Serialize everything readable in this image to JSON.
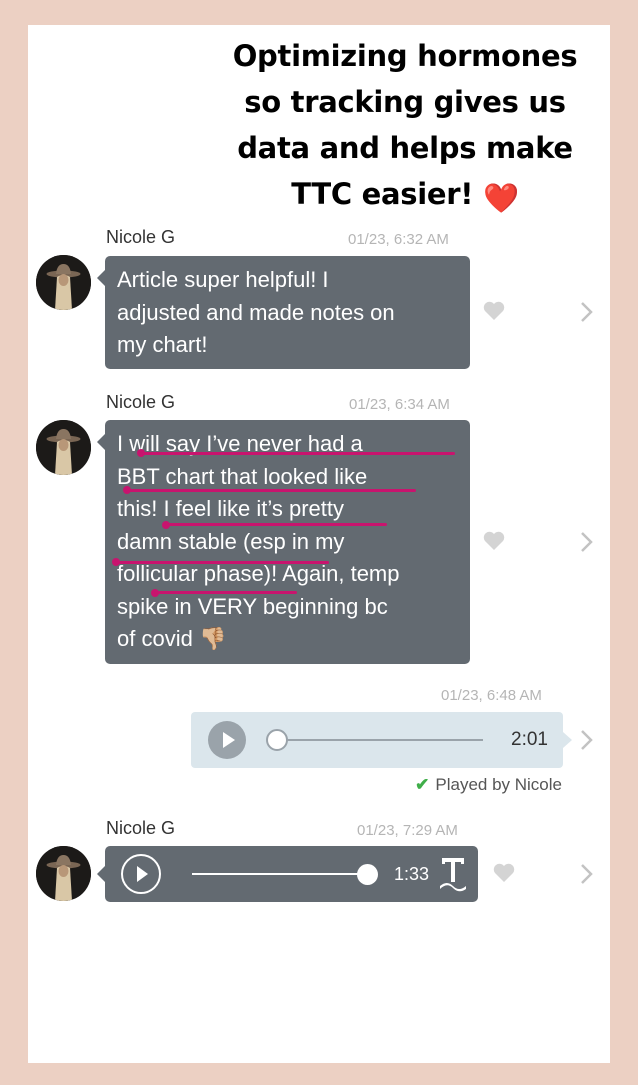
{
  "headline": {
    "line1": "Optimizing hormones",
    "line2": "so tracking gives us",
    "line3": "data and helps make",
    "line4": "TTC easier!",
    "emoji": "❤️"
  },
  "messages": [
    {
      "sender": "Nicole G",
      "time": "01/23, 6:32 AM",
      "lines": [
        "Article super helpful! I",
        "adjusted and made notes on",
        "my chart!"
      ]
    },
    {
      "sender": "Nicole G",
      "time": "01/23, 6:34 AM",
      "lines": [
        "I will say I’ve never had a",
        "BBT chart that looked like",
        "this! I feel like it’s pretty",
        "damn stable (esp in my",
        "follicular phase)! Again, temp",
        "spike in VERY beginning bc",
        "of covid"
      ],
      "emoji": "👎🏼"
    }
  ],
  "outgoing_voice": {
    "time": "01/23, 6:48 AM",
    "duration": "2:01",
    "progress": 0,
    "status": "Played by Nicole",
    "status_icon": "check-icon"
  },
  "incoming_voice": {
    "sender": "Nicole G",
    "time": "01/23, 7:29 AM",
    "duration": "1:33",
    "progress": 1.0
  },
  "colors": {
    "background": "#ecd0c3",
    "bubble": "#636a71",
    "outgoing_bubble": "#dbe6ec",
    "annotation": "#c8146e",
    "check": "#3fae49"
  },
  "icons": [
    "heart-icon",
    "chevron-right-icon",
    "play-icon",
    "transcribe-icon",
    "avatar"
  ]
}
